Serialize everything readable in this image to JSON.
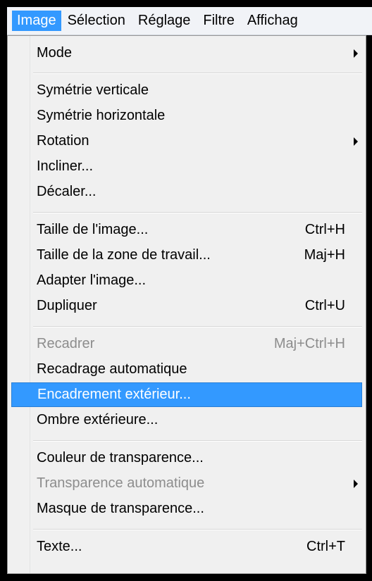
{
  "menubar": {
    "items": [
      "Image",
      "Sélection",
      "Réglage",
      "Filtre",
      "Affichag"
    ]
  },
  "menu": {
    "items": [
      {
        "label": "Mode",
        "shortcut": "",
        "submenu": true,
        "disabled": false
      },
      {
        "label": "Symétrie verticale",
        "shortcut": "",
        "submenu": false,
        "disabled": false
      },
      {
        "label": "Symétrie horizontale",
        "shortcut": "",
        "submenu": false,
        "disabled": false
      },
      {
        "label": "Rotation",
        "shortcut": "",
        "submenu": true,
        "disabled": false
      },
      {
        "label": "Incliner...",
        "shortcut": "",
        "submenu": false,
        "disabled": false
      },
      {
        "label": "Décaler...",
        "shortcut": "",
        "submenu": false,
        "disabled": false
      },
      {
        "label": "Taille de l'image...",
        "shortcut": "Ctrl+H",
        "submenu": false,
        "disabled": false
      },
      {
        "label": "Taille de la zone de travail...",
        "shortcut": "Maj+H",
        "submenu": false,
        "disabled": false
      },
      {
        "label": "Adapter l'image...",
        "shortcut": "",
        "submenu": false,
        "disabled": false
      },
      {
        "label": "Dupliquer",
        "shortcut": "Ctrl+U",
        "submenu": false,
        "disabled": false
      },
      {
        "label": "Recadrer",
        "shortcut": "Maj+Ctrl+H",
        "submenu": false,
        "disabled": true
      },
      {
        "label": "Recadrage automatique",
        "shortcut": "",
        "submenu": false,
        "disabled": false
      },
      {
        "label": "Encadrement extérieur...",
        "shortcut": "",
        "submenu": false,
        "disabled": false,
        "highlighted": true
      },
      {
        "label": "Ombre extérieure...",
        "shortcut": "",
        "submenu": false,
        "disabled": false
      },
      {
        "label": "Couleur de transparence...",
        "shortcut": "",
        "submenu": false,
        "disabled": false
      },
      {
        "label": "Transparence automatique",
        "shortcut": "",
        "submenu": true,
        "disabled": true
      },
      {
        "label": "Masque de transparence...",
        "shortcut": "",
        "submenu": false,
        "disabled": false
      },
      {
        "label": "Texte...",
        "shortcut": "Ctrl+T",
        "submenu": false,
        "disabled": false
      }
    ]
  },
  "colors": {
    "highlight": "#3399ff",
    "disabled_text": "#8d8d8d",
    "menu_background": "#f0f0f0"
  }
}
